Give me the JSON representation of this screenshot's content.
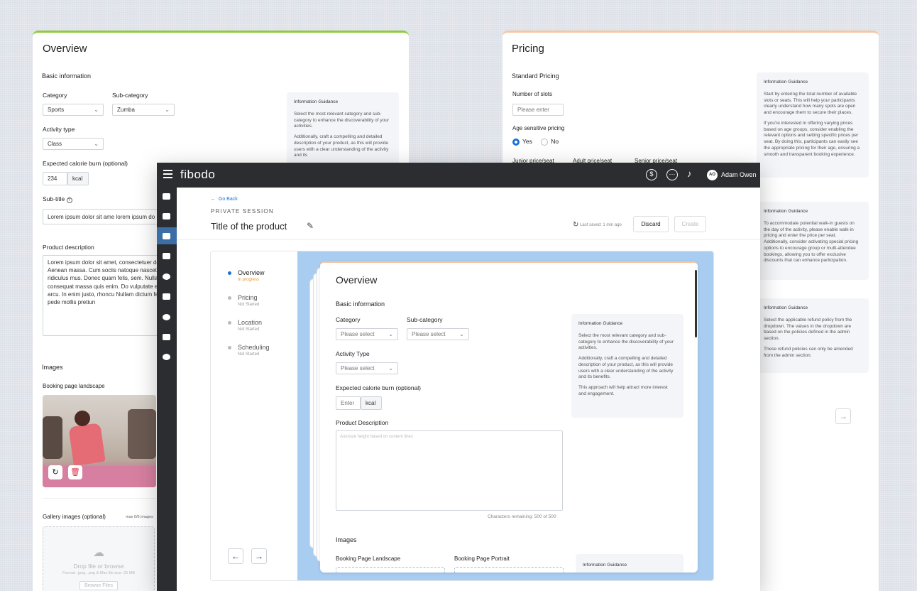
{
  "left_card": {
    "title": "Overview",
    "basic_info": "Basic information",
    "category_label": "Category",
    "category_value": "Sports",
    "subcategory_label": "Sub-category",
    "subcategory_value": "Zumba",
    "activity_type_label": "Activity type",
    "activity_type_value": "Class",
    "calorie_label": "Expected calorie burn (optional)",
    "calorie_value": "234",
    "calorie_unit": "kcal",
    "subtitle_label": "Sub-title",
    "subtitle_value": "Lorem ipsum dolor sit ame lorem ipsum do",
    "product_desc_label": "Product description",
    "product_desc_value": "Lorem ipsum dolor sit amet, consectetuer dolor. Aenean massa. Cum sociis natoque nascetur ridiculus mus. Donec quam felis, sem. Nulla consequat massa quis enim. Do vulputate eget, arcu. In enim justo, rhoncu Nullam dictum felis eu pede mollis pretiun",
    "guidance_title": "Information Guidance",
    "guidance_p1": "Select the most relevant category and sub-category to enhance the discoverability of your activities.",
    "guidance_p2": "Additionally, craft a compelling and detailed description of your product, as this will provide users with a clear understanding of the activity and its",
    "images_label": "Images",
    "booking_landscape_label": "Booking page landscape",
    "gallery_label": "Gallery images (optional)",
    "gallery_count": "max 0/6 images",
    "drop_text": "Drop file or browse",
    "drop_format": "Format: .jpeg, .png & Max file size: 25 MB",
    "browse_button": "Browse Files"
  },
  "right_card": {
    "title": "Pricing",
    "standard_pricing": "Standard Pricing",
    "slots_label": "Number of slots",
    "slots_placeholder": "Please enter",
    "age_label": "Age sensitive pricing",
    "yes": "Yes",
    "no": "No",
    "junior": "Junior price/seat",
    "adult": "Adult price/seat",
    "senior": "Senior price/seat",
    "guidance1_title": "Information Guidance",
    "guidance1_p1": "Start by entering the total number of available slots or seats. This will help your participants clearly understand how many spots are open and encourage them to secure their places.",
    "guidance1_p2": "If you're interested in offering varying prices based on age groups, consider enabling the relevant options and setting specific prices per seat. By doing this, participants can easily see the appropriate pricing for their age, ensuring a smooth and transparent booking experience.",
    "guidance2_title": "Information Guidance",
    "guidance2_p1": "To accommodate potential walk-in guests on the day of the activity, please enable walk-in pricing and enter the price per seat. Additionally, consider activating special pricing options to encourage group or multi-attendee bookings, allowing you to offer exclusive discounts that can enhance participation.",
    "guidance3_title": "Information Guidance",
    "guidance3_p1": "Select the applicable refund policy from the dropdown. The values in the dropdown are based on the policies defined in the admin section.",
    "guidance3_p2": "These refund policies can only be amended from the admin section."
  },
  "app": {
    "brand": "fibodo",
    "user_initials": "AO",
    "user_name": "Adam Owen",
    "go_back": "Go Back",
    "eyebrow": "PRIVATE SESSION",
    "product_title": "Title of the product",
    "last_saved": "Last saved: 1 min ago",
    "discard": "Discard",
    "create": "Create"
  },
  "steps": [
    {
      "name": "Overview",
      "status": "In progress"
    },
    {
      "name": "Pricing",
      "status": "Not Started"
    },
    {
      "name": "Location",
      "status": "Not Started"
    },
    {
      "name": "Scheduling",
      "status": "Not Started"
    }
  ],
  "form": {
    "title": "Overview",
    "basic_info": "Basic information",
    "category_label": "Category",
    "category_placeholder": "Please select",
    "subcategory_label": "Sub-category",
    "subcategory_placeholder": "Please select",
    "activity_type_label": "Activity Type",
    "activity_type_placeholder": "Please select",
    "calorie_label": "Expected calorie burn (optional)",
    "calorie_placeholder": "Enter",
    "calorie_unit": "kcal",
    "desc_label": "Product Description",
    "desc_placeholder": "Autosize height based on content lines",
    "chars_remaining": "Characters remaining: 500 of 500",
    "images_label": "Images",
    "landscape_label": "Booking Page Landscape",
    "portrait_label": "Booking Page Portrait",
    "guidance_title": "Information Guidance",
    "guidance_p1": "Select the most relevant category and sub-category to enhance the discoverability of your activities.",
    "guidance_p2": "Additionally, craft a compelling and detailed description of your product, as this will provide users with a clear understanding of the activity and its benefits.",
    "guidance_p3": "This approach will help attract more interest and engagement.",
    "guidance2_title": "Information Guidance"
  },
  "colors": {
    "accent_blue": "#1673d2",
    "progress_orange": "#f0901c",
    "overview_bar": "#8fcb3c",
    "pricing_bar": "#f6c7a2",
    "frame_blue": "#a9cdf1",
    "topbar": "#2b2d30"
  }
}
